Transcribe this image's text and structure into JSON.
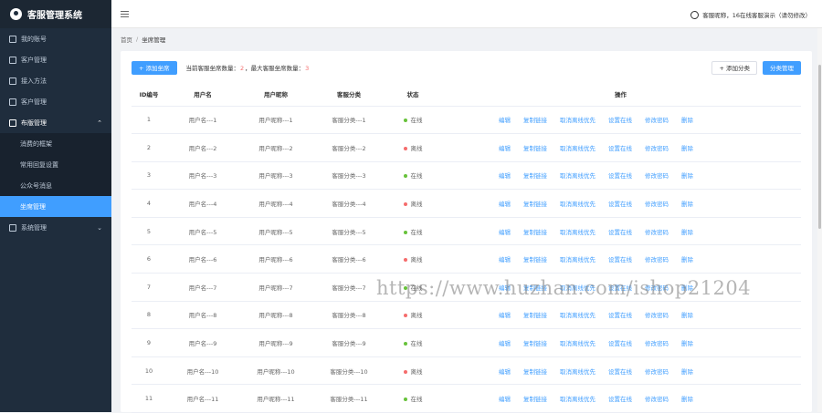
{
  "app": {
    "title": "客服管理系统"
  },
  "sidebar": {
    "items": [
      {
        "label": "我的账号"
      },
      {
        "label": "客户管理"
      },
      {
        "label": "接入方法"
      },
      {
        "label": "客户管理"
      }
    ],
    "group": {
      "label": "布版管理",
      "children": [
        {
          "label": "消费的框架",
          "active": false
        },
        {
          "label": "常用回复设置",
          "active": false
        },
        {
          "label": "公众号消息",
          "active": false
        },
        {
          "label": "坐席管理",
          "active": true
        }
      ]
    },
    "last_item": {
      "label": "系统管理"
    }
  },
  "topbar": {
    "user_text": "客服昵称，16在线客服演示（请勿修改）"
  },
  "breadcrumb": {
    "home": "首页",
    "current": "坐席管理"
  },
  "toolbar": {
    "add_button": "+ 添加坐席",
    "stat_prefix": "当前客服坐席数量：",
    "stat_current": "2",
    "stat_sep": "，最大客服坐席数量：",
    "stat_max": "3",
    "add_category_button": "+ 添加分类",
    "category_manage_button": "分类管理"
  },
  "table": {
    "headers": [
      "ID编号",
      "用户名",
      "用户昵称",
      "客服分类",
      "状态",
      "操作"
    ],
    "actions": [
      "编辑",
      "复制链接",
      "取消离线优先",
      "设置在线",
      "修改密码",
      "删除"
    ],
    "status_colors": {
      "online": "#67c23a",
      "offline": "#f56c6c"
    },
    "rows": [
      {
        "id": "1",
        "username": "用户名---1",
        "nickname": "用户昵称---1",
        "category": "客服分类---1",
        "status": "在线",
        "online": true
      },
      {
        "id": "2",
        "username": "用户名---2",
        "nickname": "用户昵称---2",
        "category": "客服分类---2",
        "status": "离线",
        "online": false
      },
      {
        "id": "3",
        "username": "用户名---3",
        "nickname": "用户昵称---3",
        "category": "客服分类---3",
        "status": "在线",
        "online": true
      },
      {
        "id": "4",
        "username": "用户名---4",
        "nickname": "用户昵称---4",
        "category": "客服分类---4",
        "status": "离线",
        "online": false
      },
      {
        "id": "5",
        "username": "用户名---5",
        "nickname": "用户昵称---5",
        "category": "客服分类---5",
        "status": "在线",
        "online": true
      },
      {
        "id": "6",
        "username": "用户名---6",
        "nickname": "用户昵称---6",
        "category": "客服分类---6",
        "status": "离线",
        "online": false
      },
      {
        "id": "7",
        "username": "用户名---7",
        "nickname": "用户昵称---7",
        "category": "客服分类---7",
        "status": "在线",
        "online": true
      },
      {
        "id": "8",
        "username": "用户名---8",
        "nickname": "用户昵称---8",
        "category": "客服分类---8",
        "status": "离线",
        "online": false
      },
      {
        "id": "9",
        "username": "用户名---9",
        "nickname": "用户昵称---9",
        "category": "客服分类---9",
        "status": "在线",
        "online": true
      },
      {
        "id": "10",
        "username": "用户名---10",
        "nickname": "用户昵称---10",
        "category": "客服分类---10",
        "status": "离线",
        "online": false
      },
      {
        "id": "11",
        "username": "用户名---11",
        "nickname": "用户昵称---11",
        "category": "客服分类---11",
        "status": "在线",
        "online": true
      }
    ]
  },
  "watermark": "https://www.huzhan.com/ishop21204"
}
